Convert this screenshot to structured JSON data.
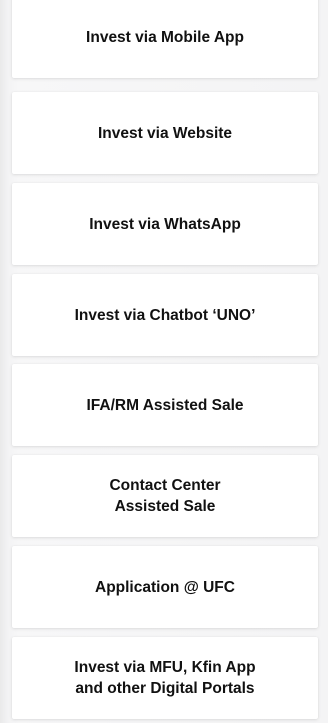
{
  "channels": [
    {
      "label": "Invest via Mobile App"
    },
    {
      "label": "Invest via Website"
    },
    {
      "label": "Invest via WhatsApp"
    },
    {
      "label": "Invest via Chatbot ‘UNO’"
    },
    {
      "label": "IFA/RM Assisted Sale"
    },
    {
      "label": "Contact Center\nAssisted Sale"
    },
    {
      "label": "Application @ UFC"
    },
    {
      "label": "Invest via MFU, Kfin App\nand other Digital Portals"
    }
  ]
}
